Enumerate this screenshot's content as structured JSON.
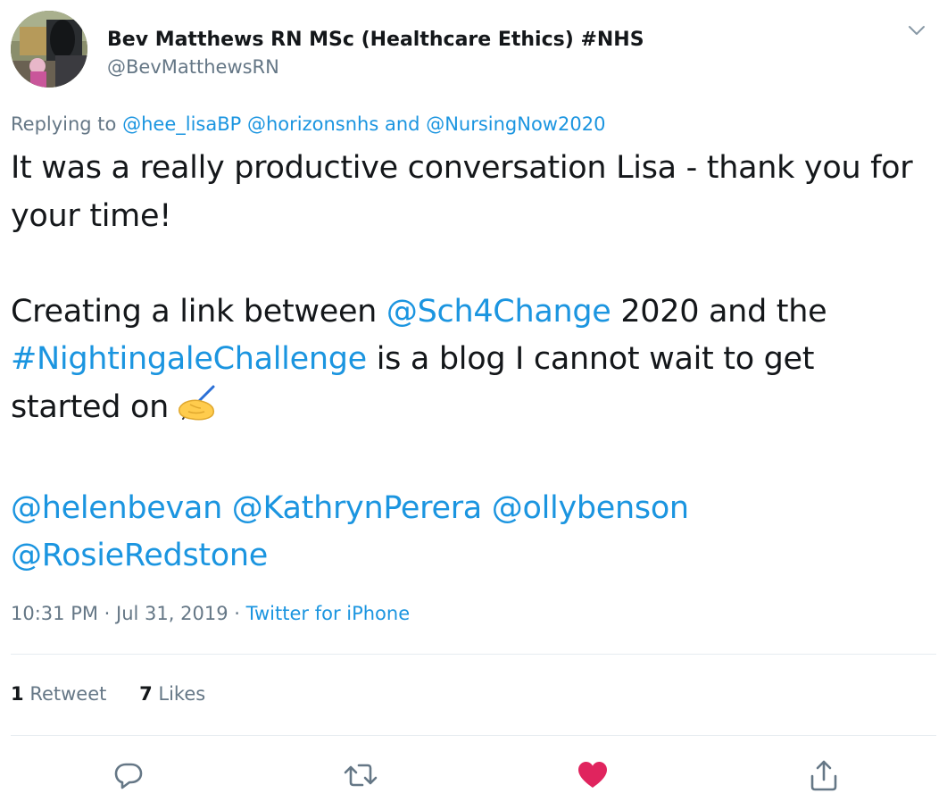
{
  "author": {
    "display_name": "Bev Matthews RN MSc (Healthcare Ethics) #NHS",
    "handle": "@BevMatthewsRN",
    "avatar_icon": "profile-photo"
  },
  "reply": {
    "prefix": "Replying to",
    "mention1": "@hee_lisaBP",
    "mention2": "@horizonsnhs",
    "conjunction": "and",
    "mention3": "@NursingNow2020"
  },
  "body": {
    "p1": "It was a really productive conversation Lisa - thank you for your time!",
    "p2_a": "Creating a link between ",
    "p2_mention": "@Sch4Change",
    "p2_b": " 2020 and the ",
    "p2_hashtag": "#NightingaleChallenge",
    "p2_c": " is a blog I cannot wait to get started on",
    "p2_emoji": "writing-hand-emoji",
    "mentions": [
      "@helenbevan",
      "@KathrynPerera",
      "@ollybenson",
      "@RosieRedstone"
    ]
  },
  "meta": {
    "time": "10:31 PM",
    "separator": "·",
    "date": "Jul 31, 2019",
    "source": "Twitter for iPhone"
  },
  "stats": {
    "retweets_count": "1",
    "retweets_label": "Retweet",
    "likes_count": "7",
    "likes_label": "Likes"
  },
  "actions": {
    "reply_icon": "reply-icon",
    "retweet_icon": "retweet-icon",
    "like_icon": "heart-icon",
    "share_icon": "share-icon"
  },
  "colors": {
    "link": "#1b95e0",
    "secondary_text": "#657786",
    "primary_text": "#14171a",
    "like": "#e0245e",
    "divider": "#e6ecf0"
  }
}
